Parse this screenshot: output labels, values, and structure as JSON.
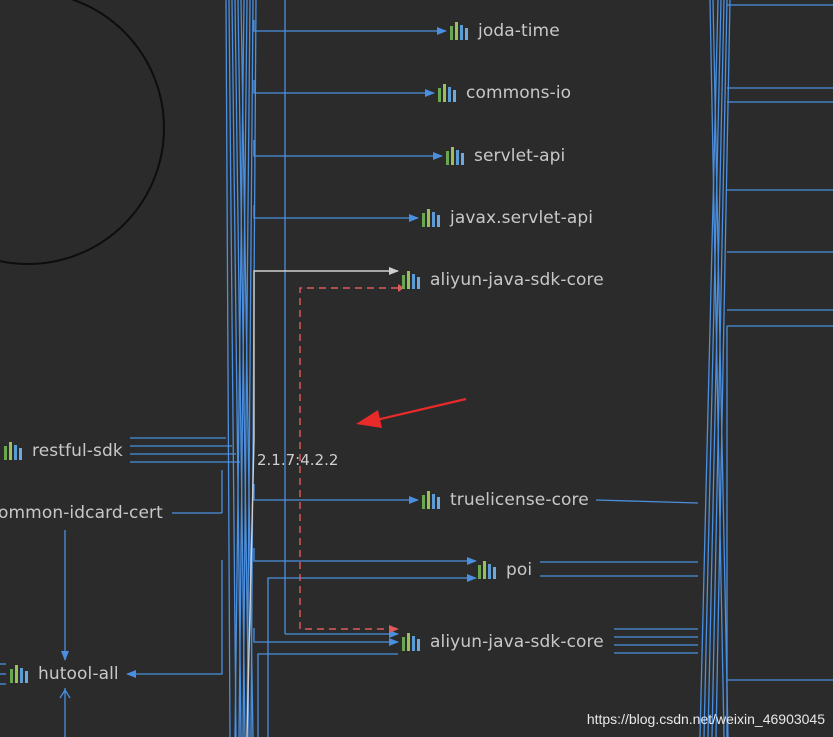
{
  "nodes": {
    "joda_time": "joda-time",
    "commons_io": "commons-io",
    "servlet_api": "servlet-api",
    "javax_servlet_api": "javax.servlet-api",
    "aliyun_core_top": "aliyun-java-sdk-core",
    "restful_sdk": "restful-sdk",
    "common_idcard_cert": "ommon-idcard-cert",
    "truelicense_core": "truelicense-core",
    "poi": "poi",
    "aliyun_core_bottom": "aliyun-java-sdk-core",
    "hutool_all": "hutool-all"
  },
  "edge_label": "2.1.7:4.2.2",
  "watermark": "https://blog.csdn.net/weixin_46903045",
  "colors": {
    "background": "#2b2b2b",
    "edge": "#4a8fe0",
    "edge_highlight": "#cfcfcf",
    "conflict_dashed": "#e05a5a",
    "annotation_arrow": "#e82a2a"
  },
  "icon": "library-bars-icon"
}
